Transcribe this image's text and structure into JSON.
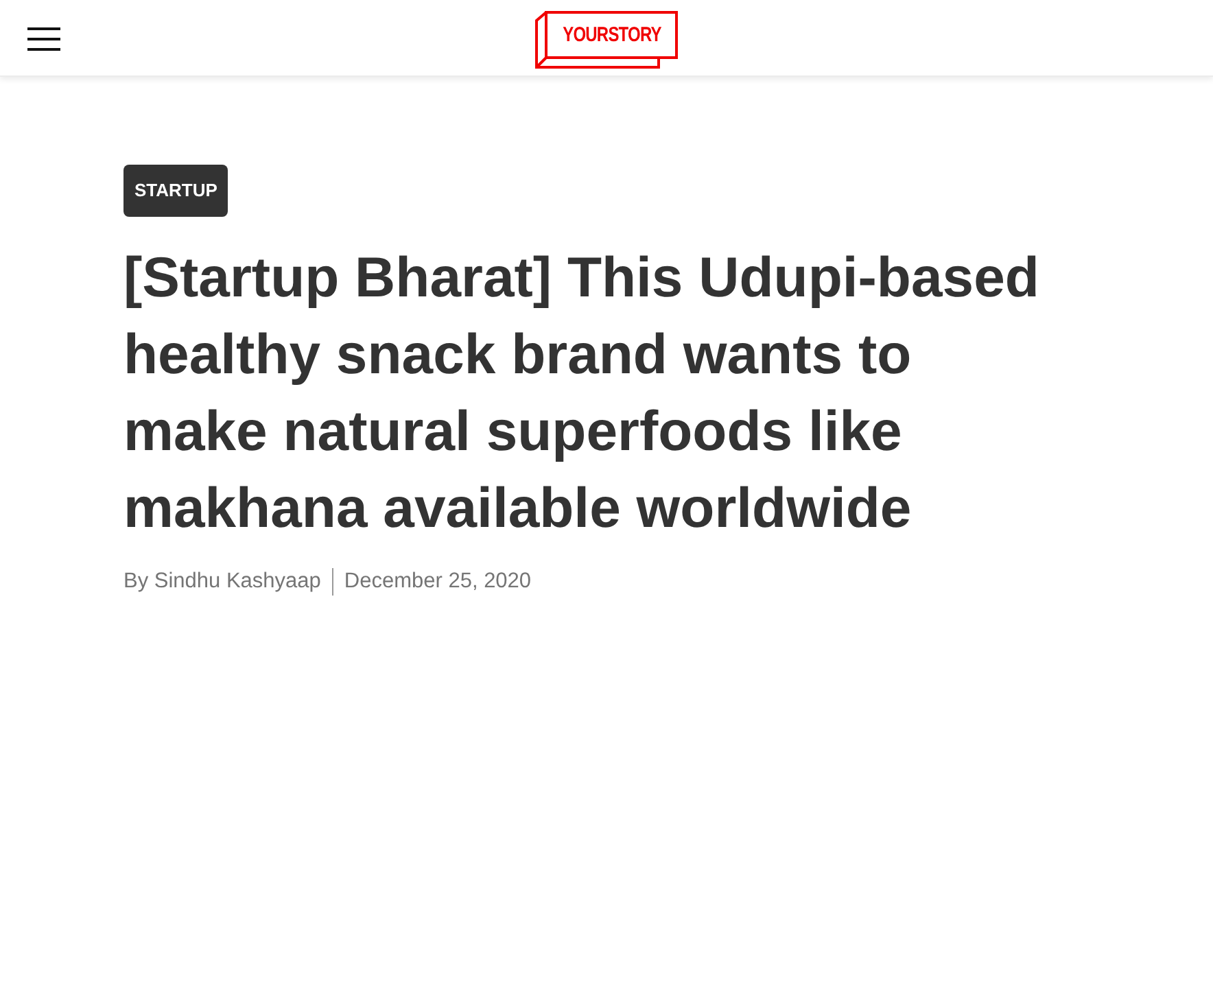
{
  "header": {
    "logo": "YOURSTORY"
  },
  "article": {
    "category": "STARTUP",
    "title": "[Startup Bharat] This Udupi-based healthy snack brand wants to make natural superfoods like makhana available worldwide",
    "author": "By Sindhu Kashyaap",
    "date": "December 25, 2020"
  }
}
